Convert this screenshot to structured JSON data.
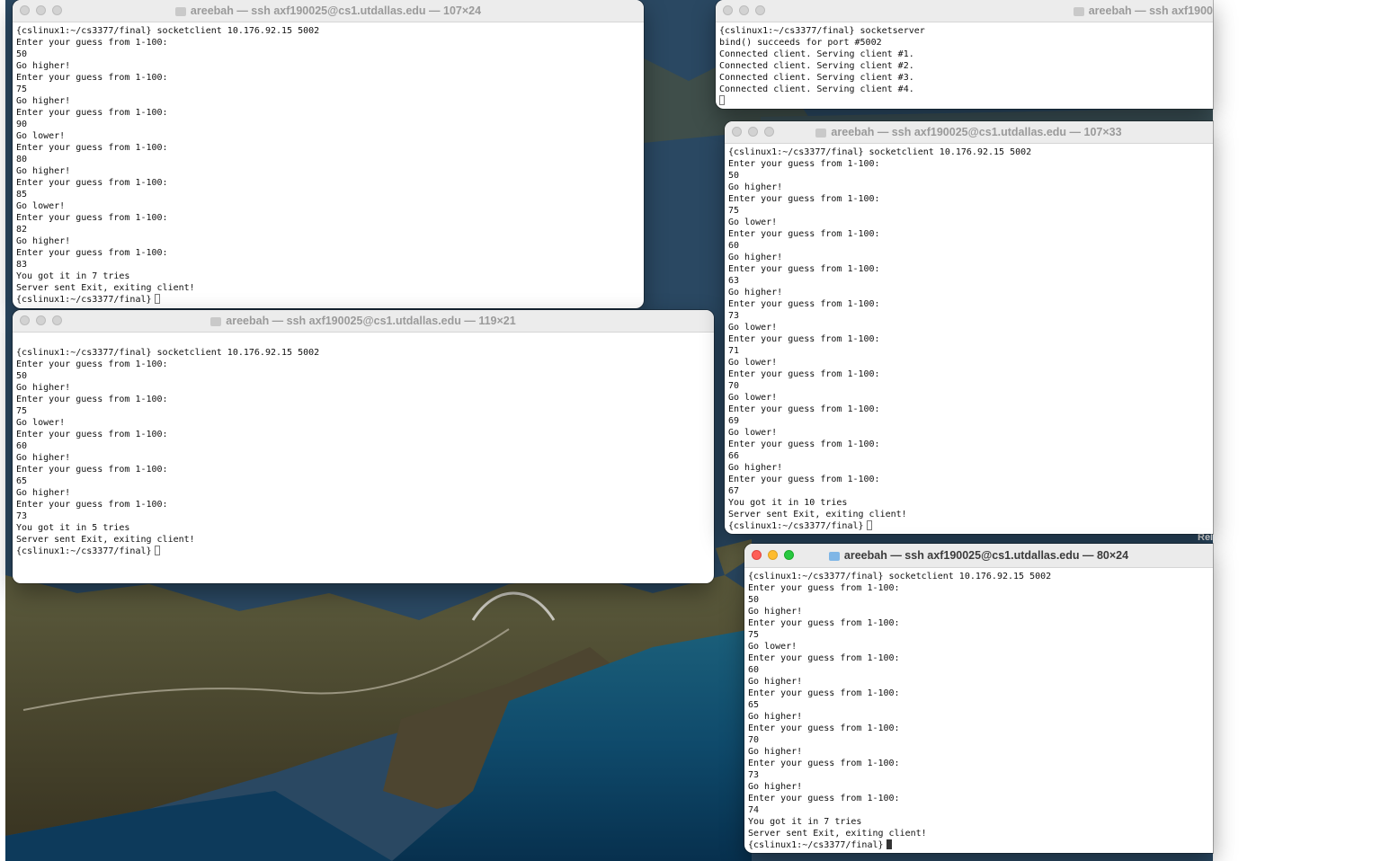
{
  "windows": [
    {
      "title": "areebah — ssh axf190025@cs1.utdallas.edu — 107×24",
      "lines": [
        "{cslinux1:~/cs3377/final} socketclient 10.176.92.15 5002",
        "Enter your guess from 1-100:",
        "50",
        "Go higher!",
        "Enter your guess from 1-100:",
        "75",
        "Go higher!",
        "Enter your guess from 1-100:",
        "90",
        "Go lower!",
        "Enter your guess from 1-100:",
        "80",
        "Go higher!",
        "Enter your guess from 1-100:",
        "85",
        "Go lower!",
        "Enter your guess from 1-100:",
        "82",
        "Go higher!",
        "Enter your guess from 1-100:",
        "83",
        "You got it in 7 tries",
        "Server sent Exit, exiting client!",
        "{cslinux1:~/cs3377/final}"
      ]
    },
    {
      "title": "areebah — ssh axf1900",
      "lines": [
        "{cslinux1:~/cs3377/final} socketserver",
        "bind() succeeds for port #5002",
        "Connected client. Serving client #1.",
        "Connected client. Serving client #2.",
        "Connected client. Serving client #3.",
        "Connected client. Serving client #4."
      ]
    },
    {
      "title": "areebah — ssh axf190025@cs1.utdallas.edu — 119×21",
      "lines": [
        "",
        "{cslinux1:~/cs3377/final} socketclient 10.176.92.15 5002",
        "Enter your guess from 1-100:",
        "50",
        "Go higher!",
        "Enter your guess from 1-100:",
        "75",
        "Go lower!",
        "Enter your guess from 1-100:",
        "60",
        "Go higher!",
        "Enter your guess from 1-100:",
        "65",
        "Go higher!",
        "Enter your guess from 1-100:",
        "73",
        "You got it in 5 tries",
        "Server sent Exit, exiting client!",
        "{cslinux1:~/cs3377/final}"
      ]
    },
    {
      "title": "areebah — ssh axf190025@cs1.utdallas.edu — 107×33",
      "lines": [
        "{cslinux1:~/cs3377/final} socketclient 10.176.92.15 5002",
        "Enter your guess from 1-100:",
        "50",
        "Go higher!",
        "Enter your guess from 1-100:",
        "75",
        "Go lower!",
        "Enter your guess from 1-100:",
        "60",
        "Go higher!",
        "Enter your guess from 1-100:",
        "63",
        "Go higher!",
        "Enter your guess from 1-100:",
        "73",
        "Go lower!",
        "Enter your guess from 1-100:",
        "71",
        "Go lower!",
        "Enter your guess from 1-100:",
        "70",
        "Go lower!",
        "Enter your guess from 1-100:",
        "69",
        "Go lower!",
        "Enter your guess from 1-100:",
        "66",
        "Go higher!",
        "Enter your guess from 1-100:",
        "67",
        "You got it in 10 tries",
        "Server sent Exit, exiting client!",
        "{cslinux1:~/cs3377/final}"
      ]
    },
    {
      "title": "areebah — ssh axf190025@cs1.utdallas.edu — 80×24",
      "lines": [
        "{cslinux1:~/cs3377/final} socketclient 10.176.92.15 5002",
        "Enter your guess from 1-100:",
        "50",
        "Go higher!",
        "Enter your guess from 1-100:",
        "75",
        "Go lower!",
        "Enter your guess from 1-100:",
        "60",
        "Go higher!",
        "Enter your guess from 1-100:",
        "65",
        "Go higher!",
        "Enter your guess from 1-100:",
        "70",
        "Go higher!",
        "Enter your guess from 1-100:",
        "73",
        "Go higher!",
        "Enter your guess from 1-100:",
        "74",
        "You got it in 7 tries",
        "Server sent Exit, exiting client!",
        "{cslinux1:~/cs3377/final}"
      ]
    }
  ],
  "desktop_fragment": "Rel"
}
